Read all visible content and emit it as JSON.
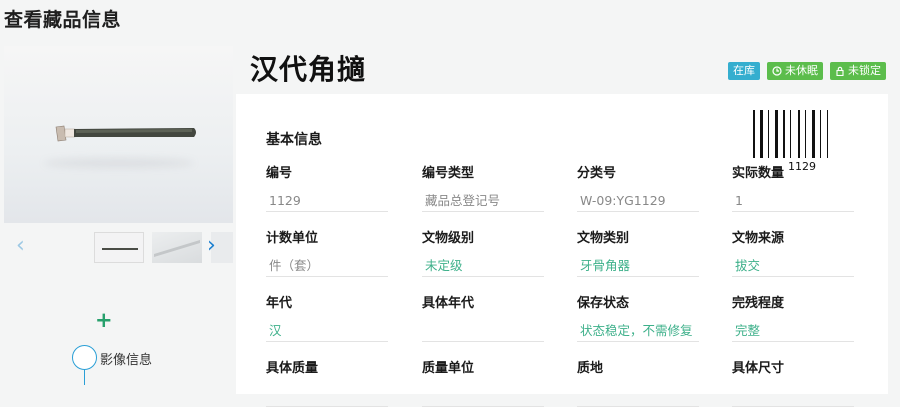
{
  "page": {
    "title": "查看藏品信息"
  },
  "relic": {
    "name": "汉代角擿",
    "badges": {
      "storage": "在库",
      "rest": "未休眠",
      "lock": "未锁定"
    },
    "barcode_number": "1129"
  },
  "media": {
    "plus": "+",
    "timeline_label": "影像信息"
  },
  "basic_info": {
    "title": "基本信息",
    "fields": [
      {
        "label": "编号",
        "value": "1129"
      },
      {
        "label": "编号类型",
        "value": "藏品总登记号"
      },
      {
        "label": "分类号",
        "value": "W-09:YG1129"
      },
      {
        "label": "实际数量",
        "value": "1"
      },
      {
        "label": "计数单位",
        "value": "件（套）"
      },
      {
        "label": "文物级别",
        "value": "未定级"
      },
      {
        "label": "文物类别",
        "value": "牙骨角器"
      },
      {
        "label": "文物来源",
        "value": "拔交"
      },
      {
        "label": "年代",
        "value": "汉"
      },
      {
        "label": "具体年代",
        "value": ""
      },
      {
        "label": "保存状态",
        "value": "状态稳定，不需修复"
      },
      {
        "label": "完残程度",
        "value": "完整"
      },
      {
        "label": "具体质量",
        "value": ""
      },
      {
        "label": "质量单位",
        "value": ""
      },
      {
        "label": "质地",
        "value": ""
      },
      {
        "label": "具体尺寸",
        "value": ""
      }
    ]
  },
  "colors": {
    "accent_teal": "#3db08a",
    "badge_blue": "#35aecf",
    "badge_green": "#5cbd4c",
    "timeline_blue": "#2a9fd6"
  },
  "icons": {
    "prev": "chevron-left-icon",
    "next": "chevron-right-icon",
    "rest": "clock-icon",
    "lock": "lock-icon",
    "add": "plus-icon"
  }
}
